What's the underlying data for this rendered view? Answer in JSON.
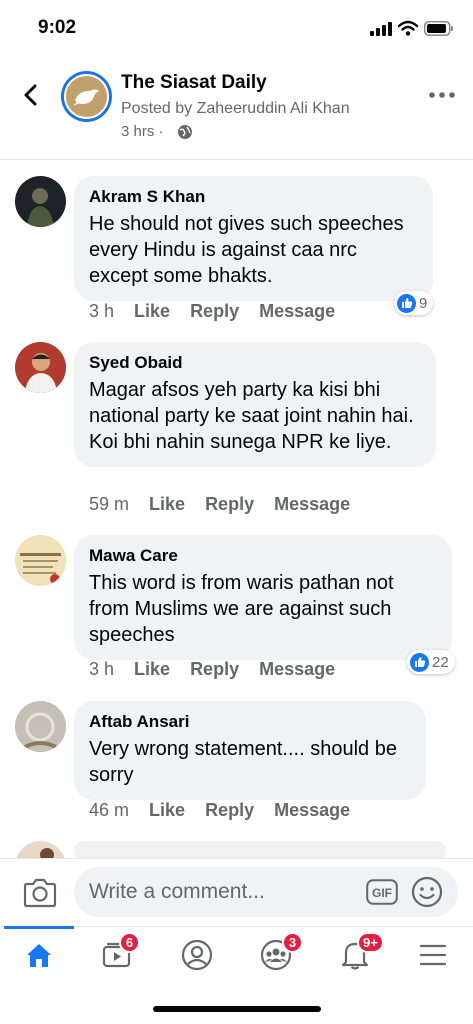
{
  "status_bar": {
    "time": "9:02"
  },
  "header": {
    "page_name": "The Siasat Daily",
    "posted_by": "Posted by Zaheeruddin Ali Khan",
    "time": "3 hrs ·"
  },
  "comments": [
    {
      "author": "Akram S Khan",
      "text": "He should not gives such speeches every Hindu is against caa nrc except some bhakts.",
      "time": "3 h",
      "like": "Like",
      "reply": "Reply",
      "message": "Message",
      "reactions": "9"
    },
    {
      "author": "Syed Obaid",
      "text": "Magar afsos yeh party ka kisi bhi national party ke saat joint nahin hai. Koi bhi nahin sunega NPR ke liye.",
      "time": "59 m",
      "like": "Like",
      "reply": "Reply",
      "message": "Message"
    },
    {
      "author": "Mawa Care",
      "text": "This word is from waris pathan not from Muslims we are against such speeches",
      "time": "3 h",
      "like": "Like",
      "reply": "Reply",
      "message": "Message",
      "reactions": "22"
    },
    {
      "author": "Aftab Ansari",
      "text": "Very wrong statement.... should be sorry",
      "time": "46 m",
      "like": "Like",
      "reply": "Reply",
      "message": "Message"
    }
  ],
  "composer": {
    "placeholder": "Write a comment...",
    "gif_label": "GIF"
  },
  "tabbar": {
    "items": [
      {
        "icon": "home-icon",
        "active": true
      },
      {
        "icon": "video-icon",
        "badge": "6"
      },
      {
        "icon": "profile-icon"
      },
      {
        "icon": "groups-icon",
        "badge": "3"
      },
      {
        "icon": "bell-icon",
        "badge": "9+"
      },
      {
        "icon": "menu-icon"
      }
    ]
  },
  "colors": {
    "accent": "#1877f2",
    "bubble": "#f0f2f5",
    "badge": "#e41e3f",
    "secondary_text": "#65676b"
  }
}
